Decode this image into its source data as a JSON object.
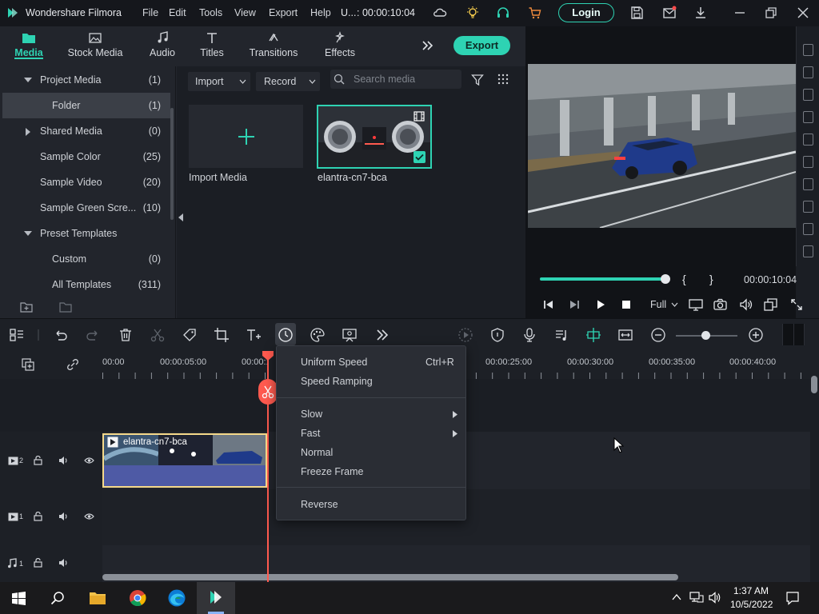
{
  "app": {
    "title": "Wondershare Filmora",
    "project_short": "U...",
    "timecode": ": 00:00:10:04"
  },
  "menu": [
    "File",
    "Edit",
    "Tools",
    "View",
    "Export",
    "Help"
  ],
  "titlebar": {
    "login_label": "Login"
  },
  "media_tabs": [
    {
      "label": "Media",
      "icon": "folder-icon",
      "active": true
    },
    {
      "label": "Stock Media",
      "icon": "image-icon"
    },
    {
      "label": "Audio",
      "icon": "music-note-icon"
    },
    {
      "label": "Titles",
      "icon": "text-icon"
    },
    {
      "label": "Transitions",
      "icon": "transition-icon"
    },
    {
      "label": "Effects",
      "icon": "effects-icon"
    }
  ],
  "export_label": "Export",
  "tree": [
    {
      "label": "Project Media",
      "count": "(1)",
      "expand": "down"
    },
    {
      "label": "Folder",
      "count": "(1)",
      "selected": true
    },
    {
      "label": "Shared Media",
      "count": "(0)",
      "expand": "right"
    },
    {
      "label": "Sample Color",
      "count": "(25)"
    },
    {
      "label": "Sample Video",
      "count": "(20)"
    },
    {
      "label": "Sample Green Scre...",
      "count": "(10)"
    },
    {
      "label": "Preset Templates",
      "count": "",
      "expand": "down"
    },
    {
      "label": "Custom",
      "count": "(0)"
    },
    {
      "label": "All Templates",
      "count": "(311)"
    }
  ],
  "media_toolbar": {
    "import_label": "Import",
    "record_label": "Record",
    "search_placeholder": "Search media"
  },
  "media_items": [
    {
      "label": "Import Media"
    },
    {
      "label": "elantra-cn7-bca"
    }
  ],
  "preview": {
    "timecode": "00:00:10:04",
    "quality": "Full",
    "progress": 1.0
  },
  "ruler": [
    "00:00",
    "00:00:05:00",
    "00:00:10:00",
    "00:00:25:00",
    "00:00:30:00",
    "00:00:35:00",
    "00:00:40:00"
  ],
  "clip": {
    "label": "elantra-cn7-bca"
  },
  "tracks": [
    {
      "label": "2"
    },
    {
      "label": "1"
    },
    {
      "label": "1"
    }
  ],
  "context_menu": {
    "uniform_speed": "Uniform Speed",
    "uniform_shortcut": "Ctrl+R",
    "speed_ramping": "Speed Ramping",
    "slow": "Slow",
    "fast": "Fast",
    "normal": "Normal",
    "freeze_frame": "Freeze Frame",
    "reverse": "Reverse"
  },
  "taskbar": {
    "time": "1:37 AM",
    "date": "10/5/2022"
  },
  "colors": {
    "accent": "#2ed3b3",
    "playhead": "#ff5a4f",
    "clip_border": "#f5d98a"
  }
}
